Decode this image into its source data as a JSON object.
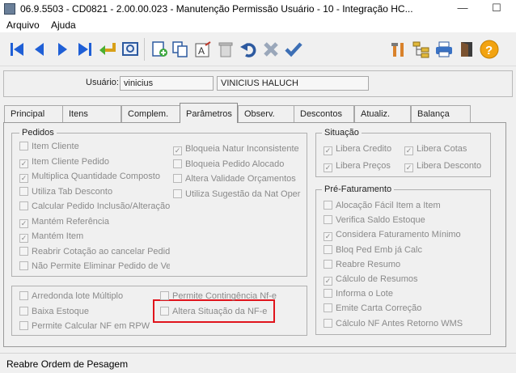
{
  "window": {
    "title": "06.9.5503 - CD0821 - 2.00.00.023 - Manutenção Permissão Usuário - 10 - Integração HC...",
    "minimize": "—",
    "maximize": "☐"
  },
  "menu": [
    "Arquivo",
    "Ajuda"
  ],
  "user": {
    "label": "Usuário:",
    "login": "vinicius",
    "name": "VINICIUS HALUCH"
  },
  "tabs": [
    "Principal",
    "Itens",
    "Complem.",
    "Parâmetros",
    "Observ.",
    "Descontos",
    "Atualiz.",
    "Balança"
  ],
  "active_tab": "Parâmetros",
  "pedidos": {
    "title": "Pedidos",
    "col1": [
      {
        "label": "Item Cliente",
        "checked": false
      },
      {
        "label": "Item Cliente Pedido",
        "checked": true
      },
      {
        "label": "Multiplica Quantidade Composto",
        "checked": true
      },
      {
        "label": "Utiliza Tab Desconto",
        "checked": false
      },
      {
        "label": "Calcular Pedido Inclusão/Alteração Item",
        "checked": false
      },
      {
        "label": "Mantém Referência",
        "checked": true
      },
      {
        "label": "Mantém Item",
        "checked": true
      },
      {
        "label": "Reabrir Cotação ao cancelar Pedido",
        "checked": false
      },
      {
        "label": "Não Permite Eliminar Pedido de Venda",
        "checked": false
      }
    ],
    "col2": [
      {
        "label": "Bloqueia Natur Inconsistente",
        "checked": true
      },
      {
        "label": "Bloqueia Pedido Alocado",
        "checked": false
      },
      {
        "label": "Altera Validade Orçamentos",
        "checked": false
      },
      {
        "label": "Utiliza Sugestão da Nat Oper",
        "checked": false
      }
    ]
  },
  "misc": {
    "col1": [
      {
        "label": "Arredonda lote Múltiplo",
        "checked": false
      },
      {
        "label": "Baixa Estoque",
        "checked": false
      },
      {
        "label": "Permite Calcular NF em RPW",
        "checked": false
      }
    ],
    "col2": [
      {
        "label": "Permite Contingência Nf-e",
        "checked": false
      },
      {
        "label": "Altera Situação da NF-e",
        "checked": false
      }
    ]
  },
  "situacao": {
    "title": "Situação",
    "items": [
      {
        "label": "Libera Credito",
        "checked": true
      },
      {
        "label": "Libera Cotas",
        "checked": true
      },
      {
        "label": "Libera Preços",
        "checked": true
      },
      {
        "label": "Libera Desconto",
        "checked": true
      }
    ]
  },
  "pre_faturamento": {
    "title": "Pré-Faturamento",
    "items": [
      {
        "label": "Alocação Fácil Item a Item",
        "checked": false
      },
      {
        "label": "Verifica Saldo Estoque",
        "checked": false
      },
      {
        "label": "Considera Faturamento Mínimo",
        "checked": true
      },
      {
        "label": "Bloq Ped Emb já Calc",
        "checked": false
      },
      {
        "label": "Reabre Resumo",
        "checked": false
      },
      {
        "label": "Cálculo de Resumos",
        "checked": true
      },
      {
        "label": "Informa o Lote",
        "checked": false
      },
      {
        "label": "Emite Carta Correção",
        "checked": false
      },
      {
        "label": "Cálculo NF Antes Retorno WMS",
        "checked": false
      }
    ]
  },
  "status": "Reabre Ordem de Pesagem",
  "toolbar": [
    "first-record-icon",
    "previous-record-icon",
    "next-record-icon",
    "last-record-icon",
    "return-icon",
    "preview-icon",
    "new-icon",
    "copy-icon",
    "edit-text-icon",
    "delete-icon",
    "undo-icon",
    "cancel-icon",
    "confirm-icon",
    "tools-icon",
    "tree-icon",
    "print-icon",
    "exit-icon",
    "help-icon"
  ],
  "colors": {
    "highlight": "#e0141c",
    "nav_blue": "#1f5fd6",
    "confirm_blue": "#3d6fb5"
  }
}
